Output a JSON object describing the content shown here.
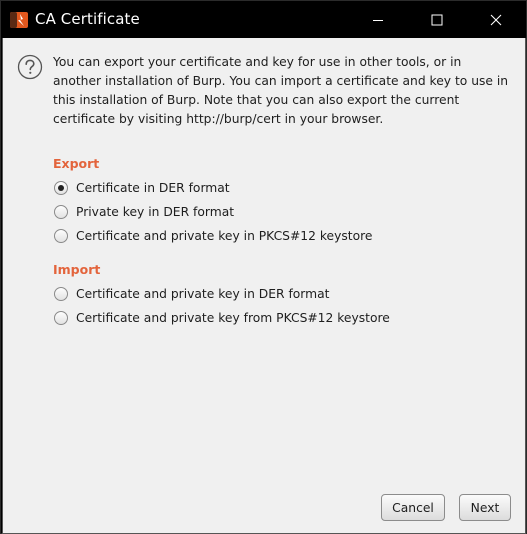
{
  "window": {
    "title": "CA Certificate",
    "app_icon": "burp-suite-icon",
    "controls": {
      "minimize": "minimize-icon",
      "maximize": "maximize-icon",
      "close": "close-icon"
    }
  },
  "help_icon": "help-question-icon",
  "description": "You can export your certificate and key for use in other tools, or in another installation of Burp. You can import a certificate and key to use in this installation of Burp. Note that you can also export the current certificate by visiting http://burp/cert in your browser.",
  "export": {
    "heading": "Export",
    "options": [
      {
        "label": "Certificate in DER format",
        "selected": true
      },
      {
        "label": "Private key in DER format",
        "selected": false
      },
      {
        "label": "Certificate and private key in PKCS#12 keystore",
        "selected": false
      }
    ]
  },
  "import": {
    "heading": "Import",
    "options": [
      {
        "label": "Certificate and private key in DER format",
        "selected": false
      },
      {
        "label": "Certificate and private key from PKCS#12 keystore",
        "selected": false
      }
    ]
  },
  "colors": {
    "section_heading": "#e3643c",
    "panel_bg": "#f0f0f0",
    "titlebar_bg": "#000000"
  },
  "buttons": {
    "cancel": "Cancel",
    "next": "Next"
  }
}
